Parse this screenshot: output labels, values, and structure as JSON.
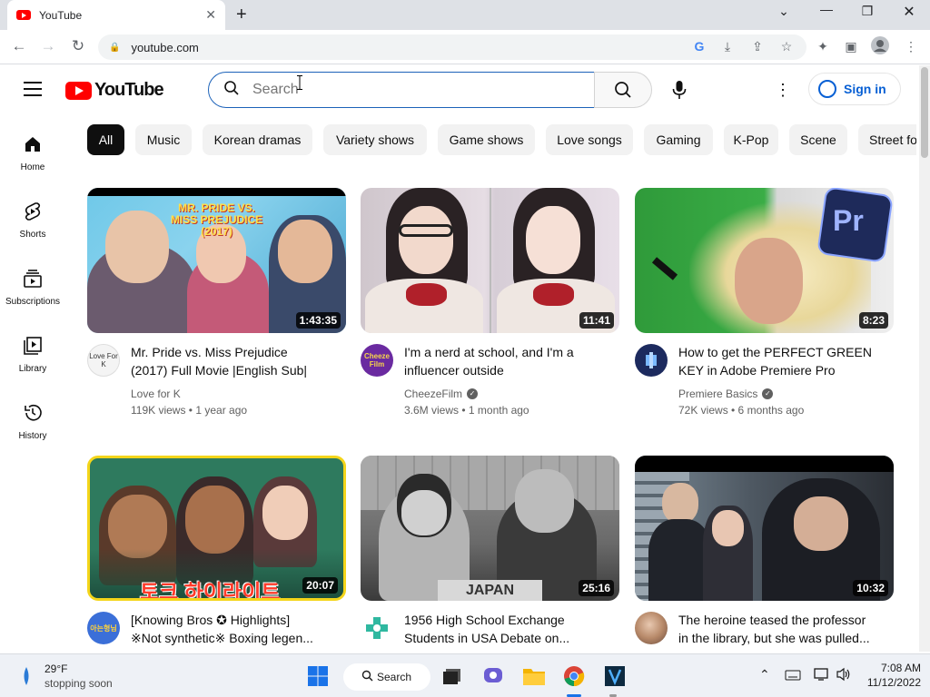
{
  "browser": {
    "tab_title": "YouTube",
    "url": "youtube.com"
  },
  "youtube": {
    "logo_text": "YouTube",
    "search_placeholder": "Search",
    "signin_label": "Sign in",
    "sidebar": [
      {
        "label": "Home",
        "icon": "home-icon"
      },
      {
        "label": "Shorts",
        "icon": "shorts-icon"
      },
      {
        "label": "Subscriptions",
        "icon": "subscriptions-icon"
      },
      {
        "label": "Library",
        "icon": "library-icon"
      },
      {
        "label": "History",
        "icon": "history-icon"
      }
    ],
    "chips": [
      "All",
      "Music",
      "Korean dramas",
      "Variety shows",
      "Game shows",
      "Love songs",
      "Gaming",
      "K-Pop",
      "Scene",
      "Street fo"
    ],
    "videos": [
      {
        "title_line1": "Mr. Pride vs. Miss Prejudice",
        "title_line2": "(2017) Full Movie |English Sub|",
        "channel": "Love for K",
        "verified": false,
        "meta": "119K views • 1 year ago",
        "duration": "1:43:35",
        "thumb_text": "MR. PRIDE VS. MISS PREJUDICE (2017)",
        "avatar_text": "Love For K"
      },
      {
        "title_line1": "I'm a nerd at school, and I'm a",
        "title_line2": "influencer outside",
        "channel": "CheezeFilm",
        "verified": true,
        "meta": "3.6M views • 1 month ago",
        "duration": "11:41",
        "thumb_text": "",
        "avatar_text": "Cheeze Film"
      },
      {
        "title_line1": "How to get the PERFECT GREEN",
        "title_line2": "KEY in Adobe Premiere Pro",
        "channel": "Premiere Basics",
        "verified": true,
        "meta": "72K views • 6 months ago",
        "duration": "8:23",
        "thumb_text": "Pr",
        "avatar_text": ""
      },
      {
        "title_line1": "[Knowing Bros ✪ Highlights]",
        "title_line2": "※Not synthetic※ Boxing legen...",
        "channel": "",
        "verified": false,
        "meta": "",
        "duration": "20:07",
        "thumb_text": "토크 하이라이트",
        "avatar_text": "아는형님"
      },
      {
        "title_line1": "1956 High School Exchange",
        "title_line2": "Students in USA Debate on...",
        "channel": "",
        "verified": false,
        "meta": "",
        "duration": "25:16",
        "thumb_text": "JAPAN",
        "avatar_text": ""
      },
      {
        "title_line1": "The heroine teased the professor",
        "title_line2": "in the library, but she was pulled...",
        "channel": "",
        "verified": false,
        "meta": "",
        "duration": "10:32",
        "thumb_text": "",
        "avatar_text": ""
      }
    ]
  },
  "taskbar": {
    "weather_temp": "29°F",
    "weather_desc": "stopping soon",
    "search_label": "Search",
    "time": "7:08 AM",
    "date": "11/12/2022"
  }
}
